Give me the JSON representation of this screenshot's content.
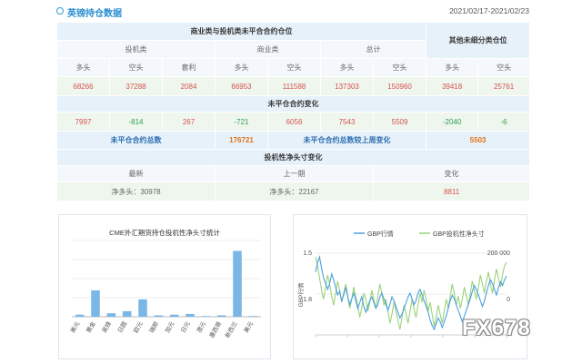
{
  "header": {
    "title": "英镑持仓数据",
    "date_range": "2021/02/17-2021/02/23"
  },
  "table": {
    "section1_title": "商业类与投机类未平合合约仓位",
    "other_title": "其他未细分类仓位",
    "groups": [
      "投机类",
      "商业类",
      "总计"
    ],
    "col_labels": [
      "多头",
      "空头",
      "套利",
      "多头",
      "空头",
      "多头",
      "空头",
      "多头",
      "空头"
    ],
    "positions": [
      "68266",
      "37288",
      "2084",
      "66953",
      "111588",
      "137303",
      "150960",
      "39418",
      "25761"
    ],
    "change_title": "未平仓合约变化",
    "changes": [
      "7997",
      "-814",
      "267",
      "-721",
      "6056",
      "7543",
      "5509",
      "-2040",
      "-6"
    ],
    "oi_total_label": "未平仓合约总数",
    "oi_total_value": "176721",
    "oi_change_label": "未平仓合约总数较上周变化",
    "oi_change_value": "5503",
    "spec_title": "投机性净头寸变化",
    "spec_cols": [
      "最新",
      "上一期",
      "变化"
    ],
    "spec_latest": "净多头：30978",
    "spec_prev": "净多头：22167",
    "spec_change": "8811"
  },
  "chart_data": [
    {
      "type": "bar",
      "title": "CME外汇期货持仓投机性净头寸统计",
      "categories": [
        "美元",
        "黄金",
        "英镑",
        "日圆",
        "欧元",
        "瑞郎",
        "加元",
        "日元",
        "澳元",
        "墨西哥",
        "新西兰",
        "美元"
      ],
      "values": [
        3,
        38,
        5,
        8,
        25,
        2,
        3,
        4,
        1,
        2,
        95,
        1
      ],
      "ylim": [
        0,
        110
      ],
      "color": "#7ab6e6"
    },
    {
      "type": "line",
      "legend": [
        "GBP行情",
        "GBP投机性净头寸"
      ],
      "ylabel": "GBP行情",
      "left_ticks": [
        "1.5",
        "1.8"
      ],
      "right_ticks": [
        "200 000",
        "0"
      ],
      "series": [
        {
          "name": "GBP行情",
          "color": "#4a9fe0",
          "values": [
            1.42,
            1.47,
            1.5,
            1.44,
            1.39,
            1.36,
            1.33,
            1.36,
            1.41,
            1.38,
            1.34,
            1.3,
            1.32,
            1.27,
            1.3,
            1.34,
            1.29,
            1.25,
            1.28,
            1.31,
            1.27,
            1.23,
            1.26,
            1.29,
            1.24,
            1.21,
            1.24,
            1.27,
            1.29,
            1.26,
            1.23,
            1.25,
            1.29,
            1.31,
            1.28,
            1.25,
            1.22,
            1.25,
            1.29,
            1.27,
            1.24,
            1.21,
            1.18,
            1.2,
            1.23,
            1.26,
            1.29,
            1.31,
            1.28,
            1.25,
            1.27,
            1.31,
            1.33,
            1.3,
            1.27,
            1.24,
            1.21,
            1.17,
            1.14,
            1.12,
            1.15,
            1.18,
            1.16,
            1.13,
            1.16,
            1.19,
            1.23,
            1.27,
            1.3,
            1.28,
            1.25,
            1.22,
            1.19,
            1.16,
            1.19,
            1.22,
            1.25,
            1.28,
            1.32,
            1.35,
            1.33,
            1.3,
            1.27,
            1.24,
            1.27,
            1.31,
            1.35,
            1.38,
            1.36,
            1.33,
            1.3,
            1.34,
            1.37,
            1.35,
            1.38,
            1.4
          ]
        },
        {
          "name": "GBP投机性净头寸",
          "color": "#9ad37a",
          "values": [
            40000,
            25000,
            5000,
            -15000,
            -30000,
            -10000,
            10000,
            -5000,
            -25000,
            -40000,
            -20000,
            0,
            -15000,
            -35000,
            -20000,
            -5000,
            -25000,
            -45000,
            -30000,
            -10000,
            -25000,
            -40000,
            -60000,
            -45000,
            -20000,
            -30000,
            -50000,
            -35000,
            -15000,
            -30000,
            -45000,
            -25000,
            -5000,
            -20000,
            -40000,
            -30000,
            -50000,
            -70000,
            -55000,
            -35000,
            -50000,
            -65000,
            -80000,
            -60000,
            -40000,
            -55000,
            -70000,
            -50000,
            -30000,
            -45000,
            -60000,
            -40000,
            -20000,
            -35000,
            -15000,
            -30000,
            -50000,
            -35000,
            -55000,
            -75000,
            -60000,
            -40000,
            -55000,
            -70000,
            -50000,
            -30000,
            -45000,
            -25000,
            -5000,
            -20000,
            -40000,
            -25000,
            -45000,
            -30000,
            -10000,
            -25000,
            -40000,
            -20000,
            0,
            -15000,
            -30000,
            -10000,
            10000,
            -5000,
            -20000,
            0,
            15000,
            -5000,
            -20000,
            0,
            20000,
            5000,
            -10000,
            10000,
            25000,
            30978
          ]
        }
      ]
    }
  ],
  "watermark": "FX678"
}
